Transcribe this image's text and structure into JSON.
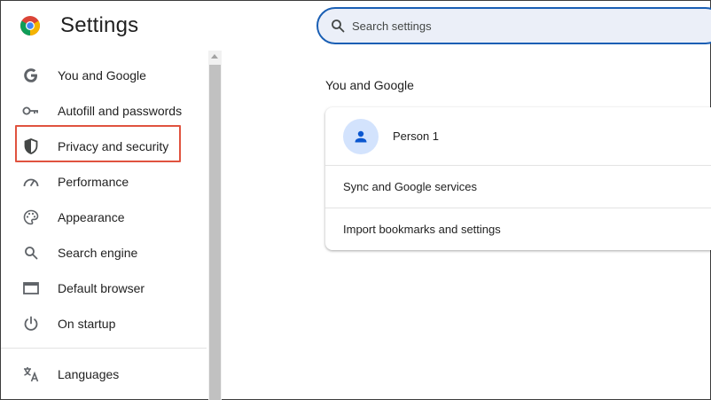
{
  "header": {
    "title": "Settings",
    "search": {
      "placeholder": "Search settings",
      "value": ""
    }
  },
  "sidebar": {
    "items": [
      {
        "label": "You and Google",
        "icon": "google-g-icon"
      },
      {
        "label": "Autofill and passwords",
        "icon": "key-icon"
      },
      {
        "label": "Privacy and security",
        "icon": "shield-icon",
        "highlighted": true
      },
      {
        "label": "Performance",
        "icon": "speedometer-icon"
      },
      {
        "label": "Appearance",
        "icon": "palette-icon"
      },
      {
        "label": "Search engine",
        "icon": "search-icon"
      },
      {
        "label": "Default browser",
        "icon": "browser-window-icon"
      },
      {
        "label": "On startup",
        "icon": "power-icon"
      },
      {
        "label": "Languages",
        "icon": "translate-icon"
      }
    ]
  },
  "main": {
    "section_title": "You and Google",
    "card": {
      "person": "Person 1",
      "rows": [
        "Sync and Google services",
        "Import bookmarks and settings"
      ]
    }
  },
  "colors": {
    "accent": "#1a5fb4",
    "highlight_border": "#e0533f",
    "avatar_bg": "#d3e3fd",
    "avatar_icon": "#0b57d0",
    "search_bg": "#ebeff8"
  }
}
